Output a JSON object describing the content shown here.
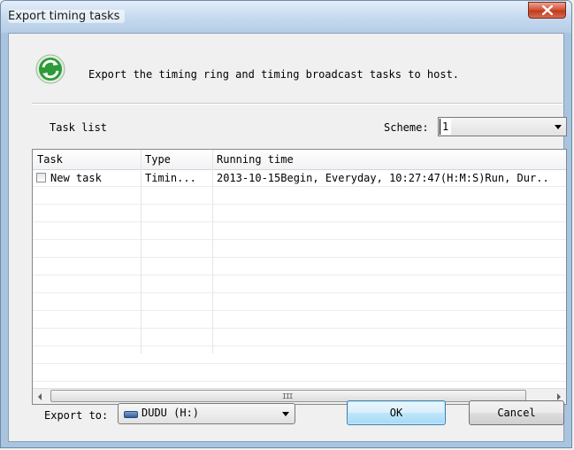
{
  "window": {
    "title": "Export timing tasks"
  },
  "header": {
    "icon": "refresh-icon",
    "message": "Export the timing ring and timing broadcast tasks to host."
  },
  "task_list": {
    "label": "Task list",
    "scheme_label": "Scheme:",
    "scheme_value": "1",
    "columns": [
      "Task",
      "Type",
      "Running time"
    ],
    "rows": [
      {
        "checked": false,
        "task": "New task",
        "type": "Timin...",
        "running_time": "2013-10-15Begin, Everyday, 10:27:47(H:M:S)Run, Dur.."
      }
    ],
    "scroll_grip": "III"
  },
  "footer": {
    "export_label": "Export to:",
    "export_value": "DUDU (H:)",
    "ok_label": "OK",
    "cancel_label": "Cancel"
  },
  "colors": {
    "title_bar": "#c5d9ee",
    "close_button": "#c13b1e",
    "ok_button": "#bee6fd",
    "icon_green": "#2e9b3a"
  }
}
